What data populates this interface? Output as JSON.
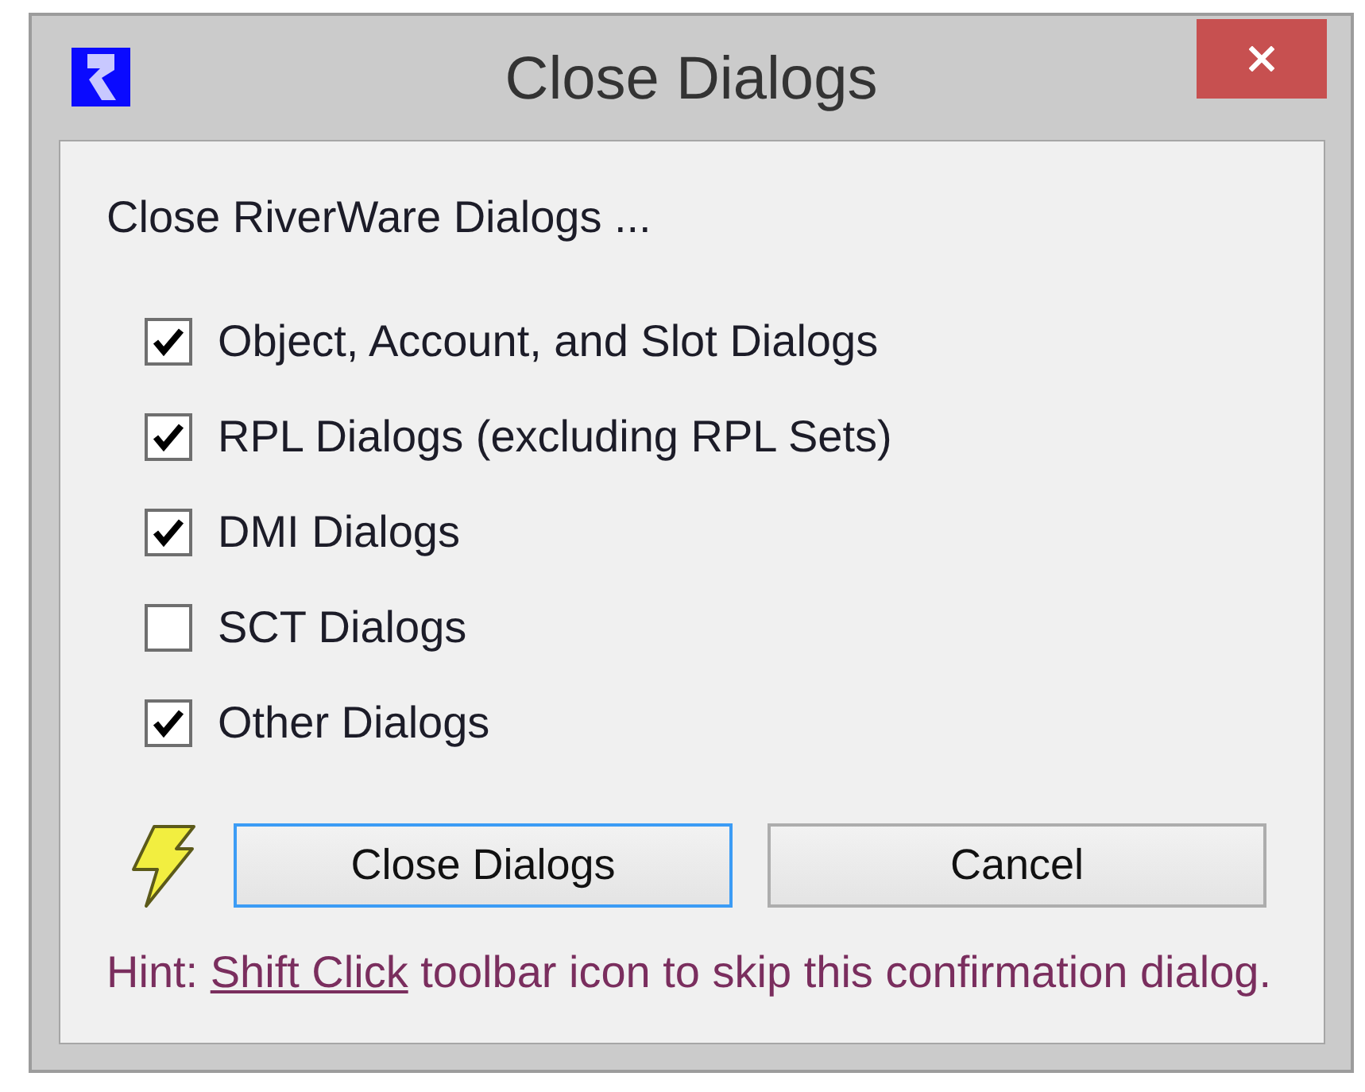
{
  "window": {
    "title": "Close Dialogs"
  },
  "prompt": "Close RiverWare Dialogs ...",
  "options": [
    {
      "label": "Object, Account, and Slot Dialogs",
      "checked": true
    },
    {
      "label": "RPL Dialogs (excluding RPL Sets)",
      "checked": true
    },
    {
      "label": "DMI Dialogs",
      "checked": true
    },
    {
      "label": "SCT Dialogs",
      "checked": false
    },
    {
      "label": "Other Dialogs",
      "checked": true
    }
  ],
  "buttons": [
    {
      "label": "Close Dialogs",
      "focused": true
    },
    {
      "label": "Cancel",
      "focused": false
    }
  ],
  "hint": {
    "prefix": "Hint:",
    "link": "Shift Click",
    "suffix": "toolbar icon to skip this confirmation dialog."
  }
}
